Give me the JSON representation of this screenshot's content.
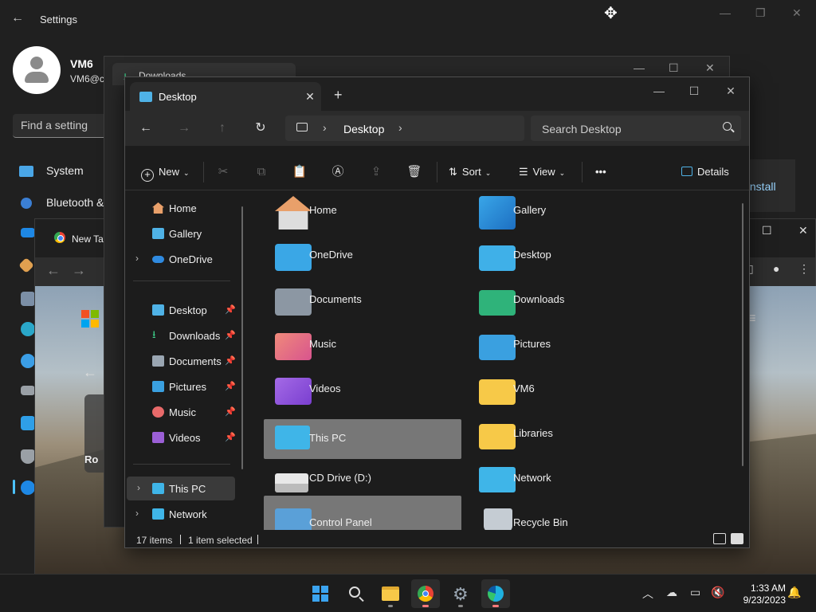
{
  "settings": {
    "title": "Settings",
    "user_name": "VM6",
    "user_email": "VM6@c",
    "find_placeholder": "Find a setting",
    "nav": [
      "System",
      "Bluetooth &"
    ],
    "right_button": "ninstall",
    "header_partial": "...."
  },
  "chrome": {
    "tab_label": "New Tab",
    "card_text": "Ro"
  },
  "downloads": {
    "tab_label": "Downloads"
  },
  "explorer": {
    "tab_label": "Desktop",
    "breadcrumb": "Desktop",
    "search_placeholder": "Search Desktop",
    "cmd": {
      "new": "New",
      "sort": "Sort",
      "view": "View",
      "more": "•••",
      "details": "Details"
    },
    "nav_pane": {
      "home": "Home",
      "gallery": "Gallery",
      "onedrive": "OneDrive",
      "desktop": "Desktop",
      "downloads": "Downloads",
      "documents": "Documents",
      "pictures": "Pictures",
      "music": "Music",
      "videos": "Videos",
      "this_pc": "This PC",
      "network": "Network"
    },
    "items": {
      "home": "Home",
      "gallery": "Gallery",
      "onedrive": "OneDrive",
      "desktop": "Desktop",
      "documents": "Documents",
      "downloads": "Downloads",
      "music": "Music",
      "pictures": "Pictures",
      "videos": "Videos",
      "vm6": "VM6",
      "this_pc": "This PC",
      "libraries": "Libraries",
      "cd_drive": "CD Drive (D:)",
      "network": "Network",
      "control_panel": "Control Panel",
      "recycle_bin": "Recycle Bin"
    },
    "status": {
      "count": "17 items",
      "selected": "1 item selected"
    }
  },
  "taskbar": {
    "time": "1:33 AM",
    "date": "9/23/2023"
  },
  "colors": {
    "accent": "#4cc2ff",
    "folder_yellow": "#f7c948",
    "selection": "#777777"
  }
}
